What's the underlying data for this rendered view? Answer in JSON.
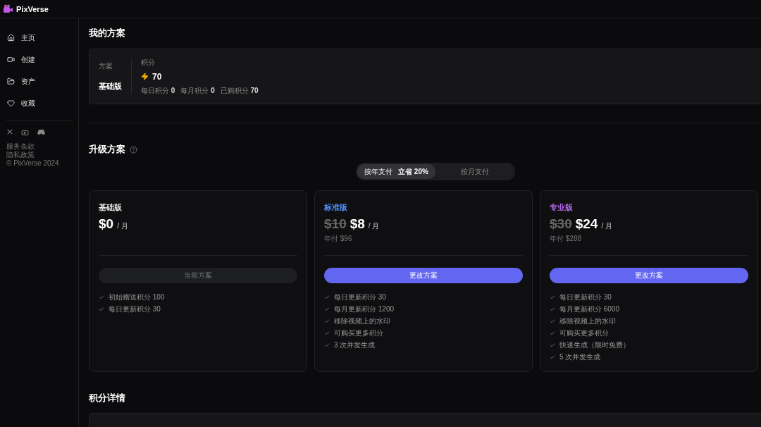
{
  "brand": "PixVerse",
  "sidebar": {
    "items": [
      {
        "label": "主页",
        "selected": false
      },
      {
        "label": "创建",
        "selected": false
      },
      {
        "label": "资产",
        "selected": false
      },
      {
        "label": "收藏",
        "selected": false
      }
    ],
    "links": [
      "服务条款",
      "隐私政策"
    ],
    "copyright": "© PixVerse 2024"
  },
  "my_plan": {
    "title": "我的方案",
    "plan_label": "方案",
    "plan_name": "基础版",
    "credits_label": "积分",
    "credits": "70",
    "breakdown": [
      {
        "label": "每日积分",
        "value": "0"
      },
      {
        "label": "每月积分",
        "value": "0"
      },
      {
        "label": "已购积分",
        "value": "70"
      }
    ]
  },
  "upgrade": {
    "title": "升级方案",
    "billing_tabs": [
      {
        "label": "按年支付",
        "badge": "立省 20%",
        "selected": true
      },
      {
        "label": "按月支付",
        "selected": false
      }
    ],
    "plans": [
      {
        "name": "基础版",
        "color": "#e6e6e6",
        "price": "$0",
        "unit": "/ 月",
        "button": "当前方案",
        "current": true,
        "features": [
          "初始赠送积分 100",
          "每日更新积分 30"
        ]
      },
      {
        "name": "标准版",
        "color": "#4f8ff7",
        "old_price": "$10",
        "price": "$8",
        "unit": "/ 月",
        "yearly": "年付 $96",
        "button": "更改方案",
        "current": false,
        "features": [
          "每日更新积分 30",
          "每月更新积分 1200",
          "移除视频上的水印",
          "可购买更多积分",
          "3 次并发生成"
        ]
      },
      {
        "name": "专业版",
        "color": "#b366e8",
        "old_price": "$30",
        "price": "$24",
        "unit": "/ 月",
        "yearly": "年付 $288",
        "button": "更改方案",
        "current": false,
        "features": [
          "每日更新积分 30",
          "每月更新积分 6000",
          "移除视频上的水印",
          "可购买更多积分",
          "快速生成（限时免费）",
          "5 次并发生成"
        ]
      }
    ]
  },
  "credit_details": {
    "title": "积分详情"
  }
}
